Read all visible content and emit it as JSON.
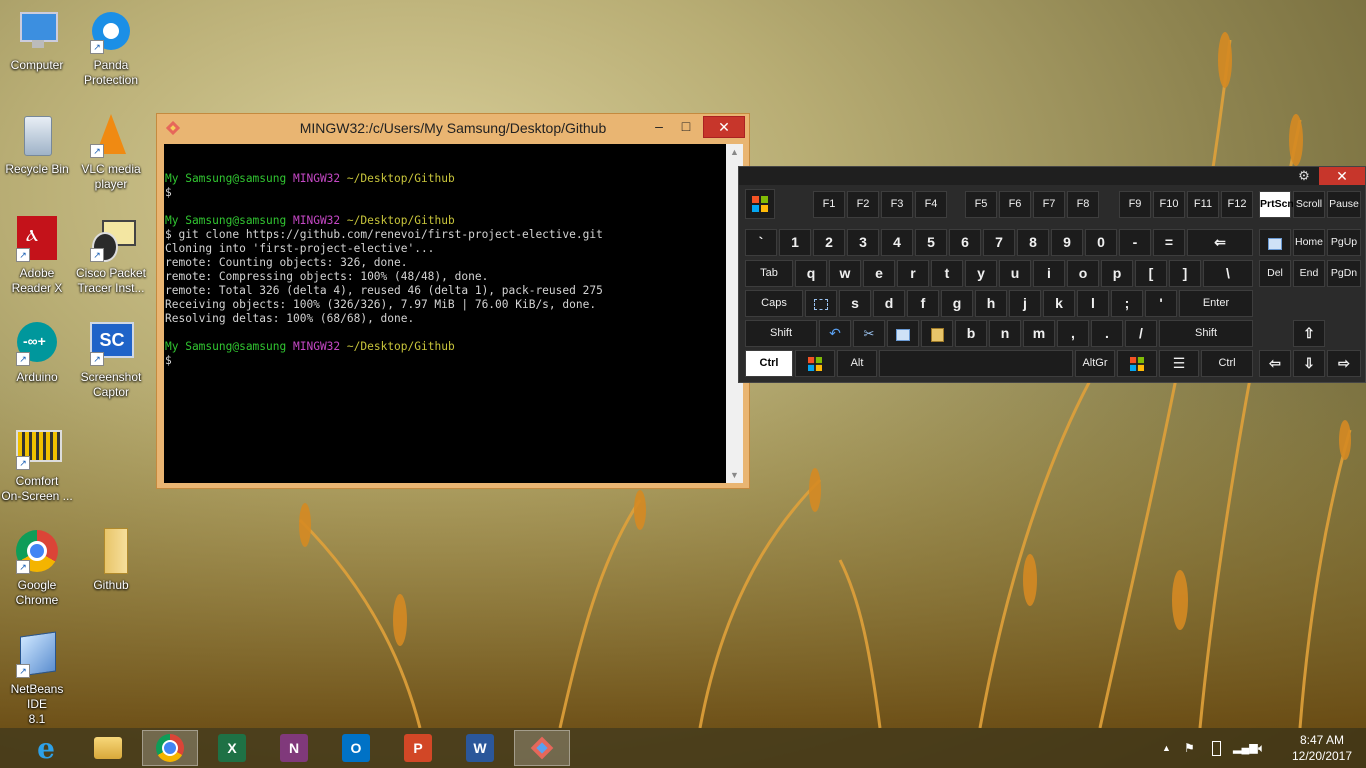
{
  "desktop": {
    "icons": [
      {
        "label1": "Computer",
        "label2": ""
      },
      {
        "label1": "Panda",
        "label2": "Protection"
      },
      {
        "label1": "Recycle Bin",
        "label2": ""
      },
      {
        "label1": "VLC media",
        "label2": "player"
      },
      {
        "label1": "Adobe",
        "label2": "Reader X"
      },
      {
        "label1": "Cisco Packet",
        "label2": "Tracer Inst..."
      },
      {
        "label1": "Arduino",
        "label2": ""
      },
      {
        "label1": "Screenshot",
        "label2": "Captor"
      },
      {
        "label1": "Comfort",
        "label2": "On-Screen ..."
      },
      {
        "label1": "Google",
        "label2": "Chrome"
      },
      {
        "label1": "Github",
        "label2": ""
      },
      {
        "label1": "NetBeans IDE",
        "label2": "8.1"
      }
    ],
    "screenshot_captor_badge": "SC"
  },
  "terminal": {
    "title": "MINGW32:/c/Users/My Samsung/Desktop/Github",
    "min": "–",
    "max": "□",
    "close": "✕",
    "prompt_user": "My Samsung@samsung",
    "prompt_env": "MINGW32",
    "prompt_path": "~/Desktop/Github",
    "dollar": "$",
    "command": "$ git clone https://github.com/renevoi/first-project-elective.git",
    "output": [
      "Cloning into 'first-project-elective'...",
      "remote: Counting objects: 326, done.",
      "remote: Compressing objects: 100% (48/48), done.",
      "remote: Total 326 (delta 4), reused 46 (delta 1), pack-reused 275",
      "Receiving objects: 100% (326/326), 7.97 MiB | 76.00 KiB/s, done.",
      "Resolving deltas: 100% (68/68), done."
    ]
  },
  "keyboard": {
    "gear": "⚙",
    "close": "✕",
    "fkeys": [
      "F1",
      "F2",
      "F3",
      "F4",
      "F5",
      "F6",
      "F7",
      "F8",
      "F9",
      "F10",
      "F11",
      "F12"
    ],
    "special_top": [
      "PrtScn",
      "Scroll",
      "Pause"
    ],
    "row1": [
      "`",
      "1",
      "2",
      "3",
      "4",
      "5",
      "6",
      "7",
      "8",
      "9",
      "0",
      "-",
      "="
    ],
    "backspace": "⇐",
    "nav1": [
      "Home",
      "PgUp"
    ],
    "row2_first": "Tab",
    "row2": [
      "q",
      "w",
      "e",
      "r",
      "t",
      "y",
      "u",
      "i",
      "o",
      "p",
      "[",
      "]",
      "\\"
    ],
    "nav2": [
      "Del",
      "End",
      "PgDn"
    ],
    "caps": "Caps",
    "row3": [
      "s",
      "d",
      "f",
      "g",
      "h",
      "j",
      "k",
      "l",
      ";",
      "'"
    ],
    "enter": "Enter",
    "shift": "Shift",
    "row4": [
      "b",
      "n",
      "m",
      ",",
      ".",
      "/"
    ],
    "up": "⇧",
    "ctrl": "Ctrl",
    "alt": "Alt",
    "altgr": "AltGr",
    "left": "⇦",
    "down": "⇩",
    "right": "⇨"
  },
  "taskbar": {
    "clock_time": "8:47 AM",
    "clock_date": "12/20/2017",
    "apps": [
      "Internet Explorer",
      "File Explorer",
      "Google Chrome",
      "Excel",
      "OneNote",
      "Outlook",
      "PowerPoint",
      "Word",
      "Git"
    ],
    "app_glyphs": {
      "excel": "X",
      "onenote": "N",
      "outlook": "O",
      "powerpoint": "P",
      "word": "W"
    },
    "tray_up": "▲"
  }
}
